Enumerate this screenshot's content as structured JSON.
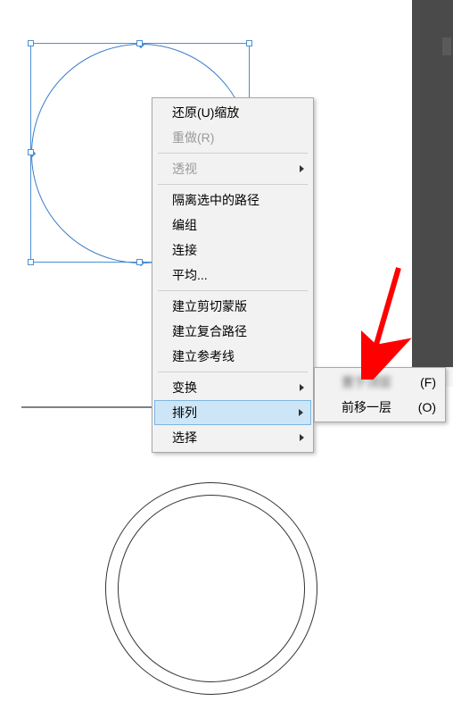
{
  "menu": {
    "undo": "还原(U)缩放",
    "redo": "重做(R)",
    "perspective": "透视",
    "isolate": "隔离选中的路径",
    "ungroup": "编组",
    "join": "连接",
    "average": "平均...",
    "clipping_mask": "建立剪切蒙版",
    "compound_path": "建立复合路径",
    "guides": "建立参考线",
    "transform": "变换",
    "arrange": "排列",
    "select": "选择"
  },
  "submenu": {
    "bring_to_front_label": "···",
    "bring_to_front_shortcut": "(F)",
    "bring_forward": "前移一层",
    "bring_forward_shortcut": "(O)"
  }
}
